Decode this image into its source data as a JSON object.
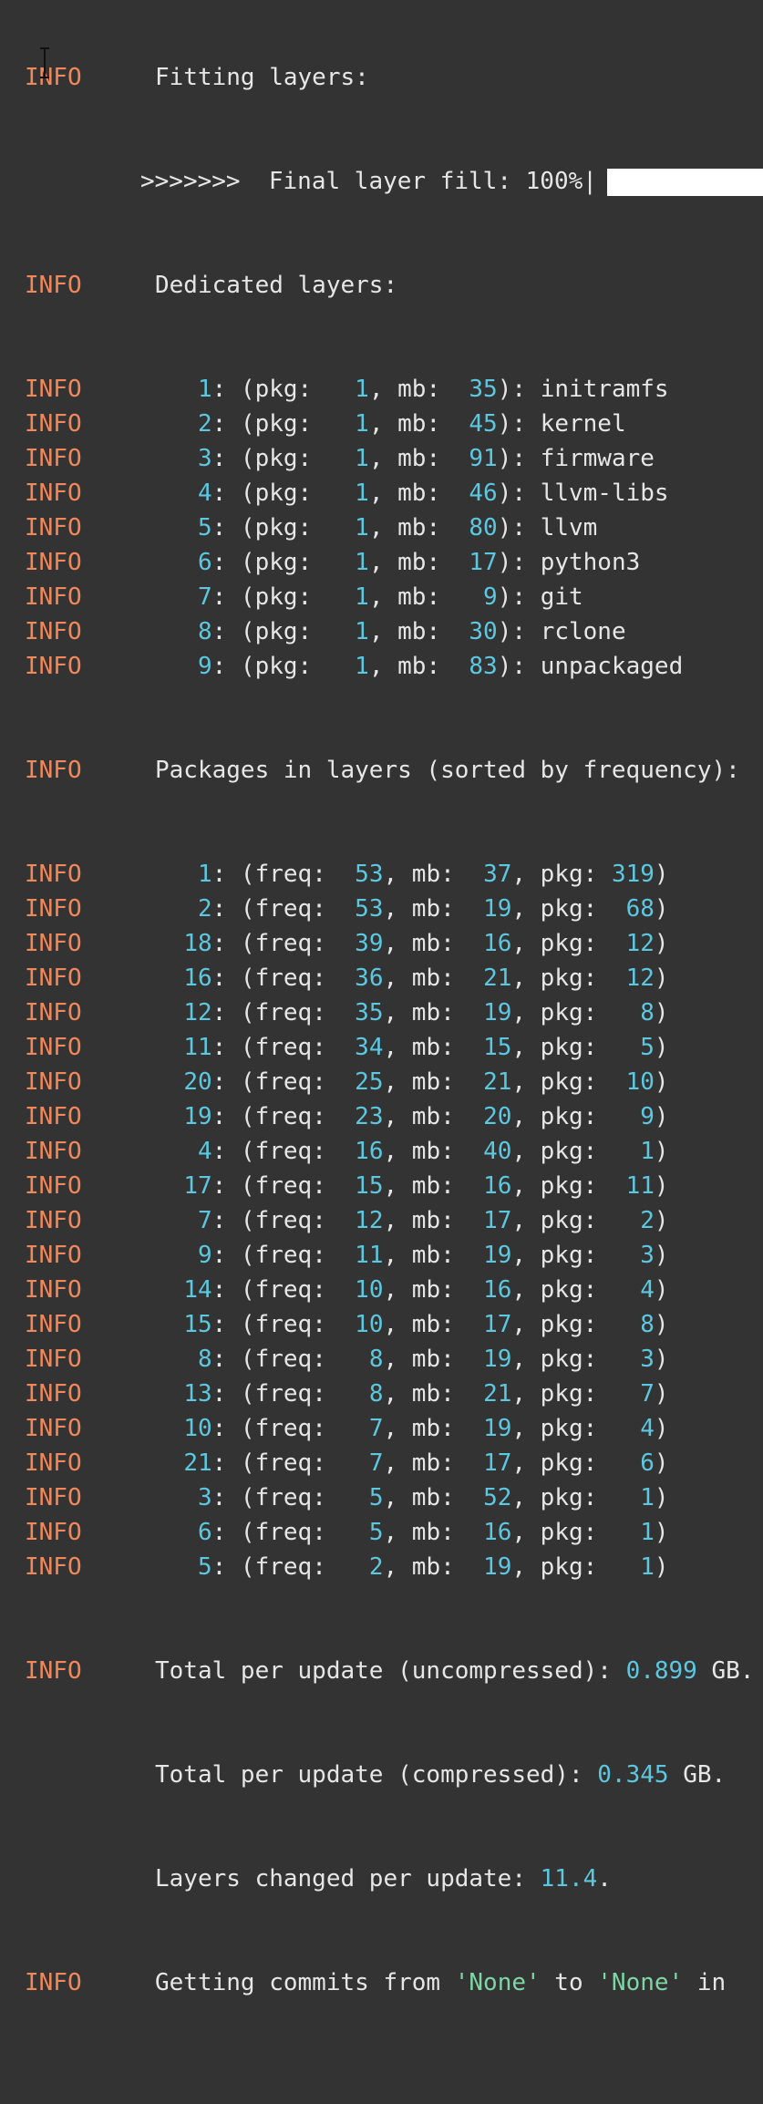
{
  "top_line": {
    "level": "INFO",
    "message": "Fitting layers:"
  },
  "progress": {
    "text": ">>>>>>>  Final layer fill: 100%|",
    "fill_percent": 100
  },
  "dedicated": {
    "level": "INFO",
    "header": "Dedicated layers:",
    "rows": [
      {
        "level": "INFO",
        "idx": " 1",
        "pkg": " 1",
        "mb": "35",
        "name": "initramfs"
      },
      {
        "level": "INFO",
        "idx": " 2",
        "pkg": " 1",
        "mb": "45",
        "name": "kernel"
      },
      {
        "level": "INFO",
        "idx": " 3",
        "pkg": " 1",
        "mb": "91",
        "name": "firmware"
      },
      {
        "level": "INFO",
        "idx": " 4",
        "pkg": " 1",
        "mb": "46",
        "name": "llvm-libs"
      },
      {
        "level": "INFO",
        "idx": " 5",
        "pkg": " 1",
        "mb": "80",
        "name": "llvm"
      },
      {
        "level": "INFO",
        "idx": " 6",
        "pkg": " 1",
        "mb": "17",
        "name": "python3"
      },
      {
        "level": "INFO",
        "idx": " 7",
        "pkg": " 1",
        "mb": " 9",
        "name": "git"
      },
      {
        "level": "INFO",
        "idx": " 8",
        "pkg": " 1",
        "mb": "30",
        "name": "rclone"
      },
      {
        "level": "INFO",
        "idx": " 9",
        "pkg": " 1",
        "mb": "83",
        "name": "unpackaged"
      }
    ]
  },
  "packages": {
    "level": "INFO",
    "header": "Packages in layers (sorted by frequency):",
    "rows": [
      {
        "level": "INFO",
        "idx": " 1",
        "freq": "53",
        "mb": "37",
        "pkg": "319"
      },
      {
        "level": "INFO",
        "idx": " 2",
        "freq": "53",
        "mb": "19",
        "pkg": " 68"
      },
      {
        "level": "INFO",
        "idx": "18",
        "freq": "39",
        "mb": "16",
        "pkg": " 12"
      },
      {
        "level": "INFO",
        "idx": "16",
        "freq": "36",
        "mb": "21",
        "pkg": " 12"
      },
      {
        "level": "INFO",
        "idx": "12",
        "freq": "35",
        "mb": "19",
        "pkg": "  8"
      },
      {
        "level": "INFO",
        "idx": "11",
        "freq": "34",
        "mb": "15",
        "pkg": "  5"
      },
      {
        "level": "INFO",
        "idx": "20",
        "freq": "25",
        "mb": "21",
        "pkg": " 10"
      },
      {
        "level": "INFO",
        "idx": "19",
        "freq": "23",
        "mb": "20",
        "pkg": "  9"
      },
      {
        "level": "INFO",
        "idx": " 4",
        "freq": "16",
        "mb": "40",
        "pkg": "  1"
      },
      {
        "level": "INFO",
        "idx": "17",
        "freq": "15",
        "mb": "16",
        "pkg": " 11"
      },
      {
        "level": "INFO",
        "idx": " 7",
        "freq": "12",
        "mb": "17",
        "pkg": "  2"
      },
      {
        "level": "INFO",
        "idx": " 9",
        "freq": "11",
        "mb": "19",
        "pkg": "  3"
      },
      {
        "level": "INFO",
        "idx": "14",
        "freq": "10",
        "mb": "16",
        "pkg": "  4"
      },
      {
        "level": "INFO",
        "idx": "15",
        "freq": "10",
        "mb": "17",
        "pkg": "  8"
      },
      {
        "level": "INFO",
        "idx": " 8",
        "freq": " 8",
        "mb": "19",
        "pkg": "  3"
      },
      {
        "level": "INFO",
        "idx": "13",
        "freq": " 8",
        "mb": "21",
        "pkg": "  7"
      },
      {
        "level": "INFO",
        "idx": "10",
        "freq": " 7",
        "mb": "19",
        "pkg": "  4"
      },
      {
        "level": "INFO",
        "idx": "21",
        "freq": " 7",
        "mb": "17",
        "pkg": "  6"
      },
      {
        "level": "INFO",
        "idx": " 3",
        "freq": " 5",
        "mb": "52",
        "pkg": "  1"
      },
      {
        "level": "INFO",
        "idx": " 6",
        "freq": " 5",
        "mb": "16",
        "pkg": "  1"
      },
      {
        "level": "INFO",
        "idx": " 5",
        "freq": " 2",
        "mb": "19",
        "pkg": "  1"
      }
    ]
  },
  "totals": {
    "level": "INFO",
    "uncompressed_label": "Total per update (uncompressed): ",
    "uncompressed_value": "0.899",
    "uncompressed_unit": " GB.",
    "compressed_label": "Total per update (compressed): ",
    "compressed_value": "0.345",
    "compressed_unit": " GB.",
    "changed_label": "Layers changed per update: ",
    "changed_value": "11.4",
    "changed_unit": "."
  },
  "last_line": {
    "level": "INFO",
    "prefix": "Getting commits from ",
    "from": "'None'",
    "middle": " to ",
    "to": "'None'",
    "suffix": " in"
  },
  "colors": {
    "background": "#333333",
    "text": "#e6e6e6",
    "level": "#f0885a",
    "number": "#5cc8e0",
    "string": "#7ed6a6"
  }
}
